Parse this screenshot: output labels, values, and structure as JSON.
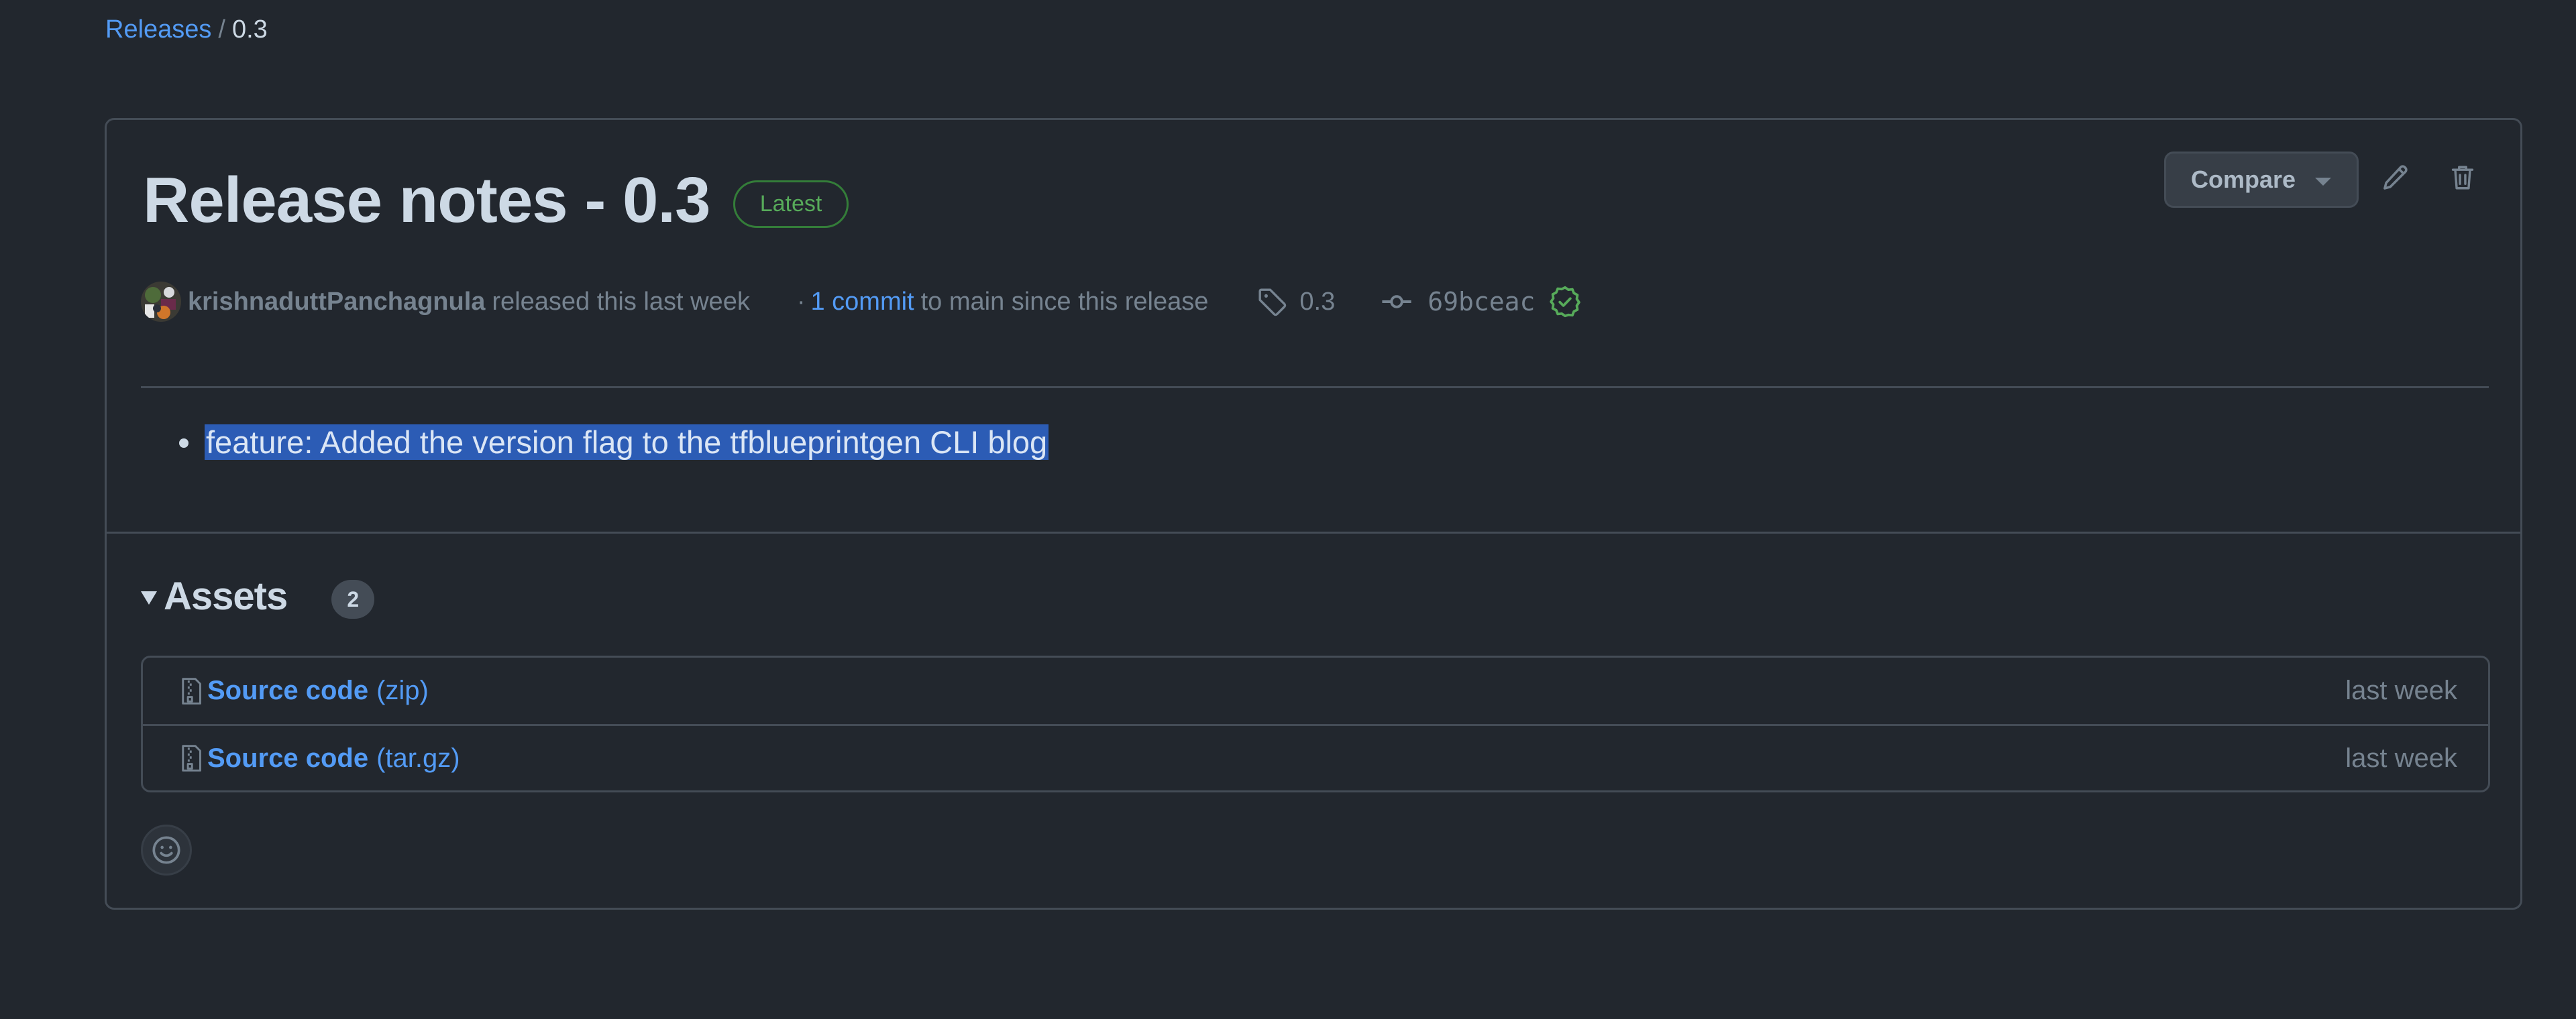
{
  "breadcrumb": {
    "parent_label": "Releases",
    "separator": "/",
    "current_label": "0.3"
  },
  "release": {
    "title": "Release notes - 0.3",
    "badge": "Latest",
    "compare_label": "Compare",
    "author": "krishnaduttPanchagnula",
    "released_text": "released this last week",
    "commit_prefix": "·",
    "commit_link": "1 commit",
    "commit_suffix": "to main since this release",
    "tag": "0.3",
    "commit_sha": "69bceac",
    "icons": {
      "edit": "pencil-icon",
      "delete": "trash-icon",
      "tag": "tag-icon",
      "commit": "git-commit-icon",
      "verified": "verified-check-icon",
      "compare_caret": "triangle-down-icon"
    },
    "notes": [
      "feature: Added the version flag to the tfblueprintgen CLI blog"
    ],
    "selected_note_index": 0
  },
  "assets": {
    "title": "Assets",
    "count": "2",
    "items": [
      {
        "name": "Source code",
        "ext": "(zip)",
        "date": "last week",
        "icon": "file-zip-icon"
      },
      {
        "name": "Source code",
        "ext": "(tar.gz)",
        "date": "last week",
        "icon": "file-zip-icon"
      }
    ]
  },
  "reactions": {
    "add_icon": "smiley-icon"
  },
  "colors": {
    "background": "#22272e",
    "border": "#444c56",
    "link": "#539bf5",
    "text_primary": "#cdd9e5",
    "text_muted": "#768390",
    "success": "#57ab5a",
    "selection": "#2c5cb5"
  }
}
